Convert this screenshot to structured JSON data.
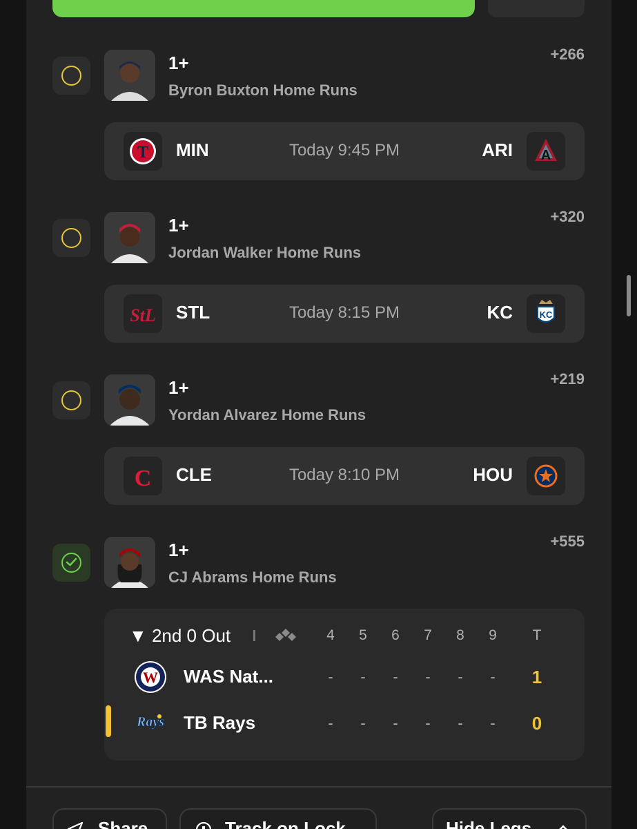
{
  "legs": [
    {
      "line": "1+",
      "prop": "Byron Buxton Home Runs",
      "odds": "+266",
      "status": "pending",
      "game": {
        "away": "MIN",
        "home": "ARI",
        "time": "Today 9:45 PM",
        "away_logo": "twins-logo-icon",
        "home_logo": "diamondbacks-logo-icon"
      }
    },
    {
      "line": "1+",
      "prop": "Jordan Walker Home Runs",
      "odds": "+320",
      "status": "pending",
      "game": {
        "away": "STL",
        "home": "KC",
        "time": "Today 8:15 PM",
        "away_logo": "cardinals-logo-icon",
        "home_logo": "royals-logo-icon"
      }
    },
    {
      "line": "1+",
      "prop": "Yordan Alvarez Home Runs",
      "odds": "+219",
      "status": "pending",
      "game": {
        "away": "CLE",
        "home": "HOU",
        "time": "Today 8:10 PM",
        "away_logo": "guardians-logo-icon",
        "home_logo": "astros-logo-icon"
      }
    },
    {
      "line": "1+",
      "prop": "CJ Abrams Home Runs",
      "odds": "+555",
      "status": "hit"
    }
  ],
  "scoreboard": {
    "inning": "▼ 2nd 0 Out",
    "headers": [
      "4",
      "5",
      "6",
      "7",
      "8",
      "9",
      "T"
    ],
    "teams": [
      {
        "name": "WAS Nat...",
        "cells": [
          "-",
          "-",
          "-",
          "-",
          "-",
          "-"
        ],
        "total": "1",
        "logo": "nationals-logo-icon"
      },
      {
        "name": "TB Rays",
        "cells": [
          "-",
          "-",
          "-",
          "-",
          "-",
          "-"
        ],
        "total": "0",
        "logo": "rays-logo-icon"
      }
    ]
  },
  "footer": {
    "share": "Share",
    "track": "Track on Lock",
    "hide": "Hide Legs"
  },
  "colors": {
    "accent_green": "#6fd04b",
    "pending_yellow": "#e6c637",
    "score_gold": "#f2c235"
  }
}
